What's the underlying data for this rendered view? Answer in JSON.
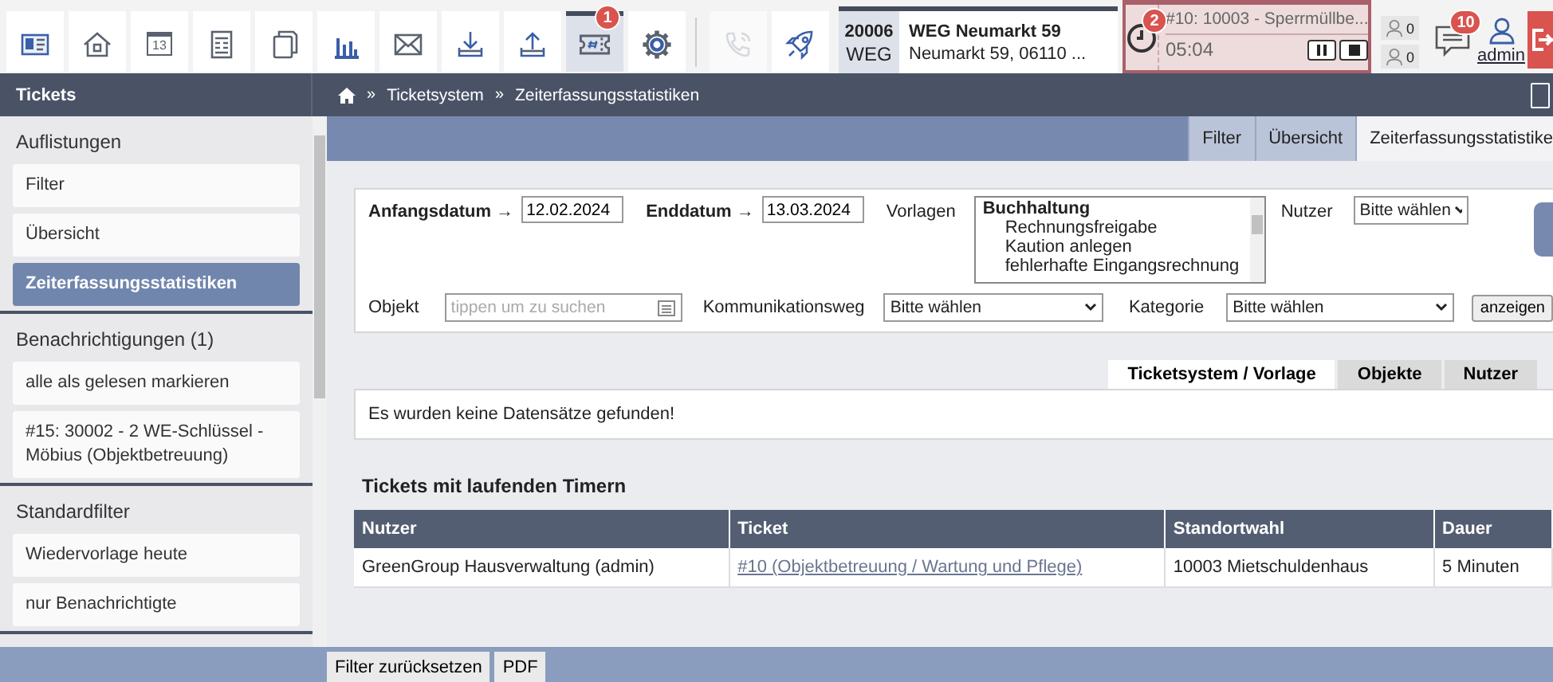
{
  "toolbar": [
    {
      "kind": "contact-card",
      "selected": false,
      "disabled": false
    },
    {
      "kind": "house",
      "selected": false,
      "disabled": false
    },
    {
      "kind": "calendar",
      "selected": false,
      "disabled": false,
      "label": "13"
    },
    {
      "kind": "form",
      "selected": false,
      "disabled": false
    },
    {
      "kind": "pages",
      "selected": false,
      "disabled": false
    },
    {
      "kind": "bar-chart",
      "selected": false,
      "disabled": false
    },
    {
      "kind": "envelope",
      "selected": false,
      "disabled": false
    },
    {
      "kind": "download",
      "selected": false,
      "disabled": false
    },
    {
      "kind": "upload",
      "selected": false,
      "disabled": false
    },
    {
      "kind": "ticket",
      "selected": true,
      "disabled": false,
      "badge": "1"
    },
    {
      "kind": "gear",
      "selected": false,
      "disabled": false
    },
    {
      "kind": "separator"
    },
    {
      "kind": "phone",
      "selected": false,
      "disabled": true
    },
    {
      "kind": "rocket",
      "selected": false,
      "disabled": false
    }
  ],
  "object": {
    "number": "20006",
    "type": "WEG",
    "name": "WEG Neumarkt 59",
    "address": "Neumarkt 59, 06110 ..."
  },
  "timer": {
    "badge": "2",
    "ticket": "#10: 10003 - Sperrmüllbe...",
    "time": "05:04"
  },
  "counters": [
    "0",
    "0"
  ],
  "messages": {
    "badge": "10"
  },
  "user": {
    "name": "admin"
  },
  "sidebar": {
    "title": "Tickets",
    "sections": [
      {
        "heading": "Auflistungen",
        "items": [
          {
            "label": "Filter",
            "selected": false
          },
          {
            "label": "Übersicht",
            "selected": false
          },
          {
            "label": "Zeiterfassungsstatistiken",
            "selected": true
          }
        ]
      },
      {
        "heading": "Benachrichtigungen (1)",
        "items": [
          {
            "label": "alle als gelesen markieren",
            "selected": false
          },
          {
            "label": "#15: 30002 - 2 WE-Schlüssel - Möbius (Objektbetreuung)",
            "selected": false
          }
        ]
      },
      {
        "heading": "Standardfilter",
        "items": [
          {
            "label": "Wiedervorlage heute",
            "selected": false
          },
          {
            "label": "nur Benachrichtigte",
            "selected": false
          }
        ]
      }
    ]
  },
  "breadcrumb": [
    {
      "separator": "»",
      "label": "Ticketsystem"
    },
    {
      "separator": "»",
      "label": "Zeiterfassungsstatistiken"
    }
  ],
  "tabs": [
    {
      "label": "Filter",
      "selected": false
    },
    {
      "label": "Übersicht",
      "selected": false
    },
    {
      "label": "Zeiterfassungsstatistike",
      "selected": true
    }
  ],
  "form": {
    "start_label": "Anfangsdatum →",
    "start": "12.02.2024",
    "end_label": "Enddatum →",
    "end": "13.03.2024",
    "templates_label": "Vorlagen",
    "templates": [
      {
        "label": "Buchhaltung",
        "kind": "group"
      },
      {
        "label": "Rechnungsfreigabe",
        "kind": "option"
      },
      {
        "label": "Kaution anlegen",
        "kind": "option"
      },
      {
        "label": "fehlerhafte Eingangsrechnung",
        "kind": "option"
      }
    ],
    "user_label": "Nutzer",
    "user": "Bitte wählen",
    "object_label": "Objekt",
    "object_placeholder": "tippen um zu suchen",
    "channel_label": "Kommunikationsweg",
    "channel": "Bitte wählen",
    "category_label": "Kategorie",
    "category": "Bitte wählen",
    "submit": "anzeigen"
  },
  "result_tabs": [
    {
      "label": "Ticketsystem / Vorlage",
      "selected": true
    },
    {
      "label": "Objekte",
      "selected": false
    },
    {
      "label": "Nutzer",
      "selected": false
    }
  ],
  "result_message": "Es wurden keine Datensätze gefunden!",
  "timers": {
    "title": "Tickets mit laufenden Timern",
    "columns": [
      "Nutzer",
      "Ticket",
      "Standortwahl",
      "Dauer"
    ],
    "rows": [
      [
        "GreenGroup Hausverwaltung (admin)",
        "#10 (Objektbetreuung / Wartung und Pflege)",
        "10003 Mietschuldenhaus",
        "5 Minuten"
      ]
    ]
  },
  "footer_buttons": [
    "Filter zurücksetzen",
    "PDF"
  ]
}
